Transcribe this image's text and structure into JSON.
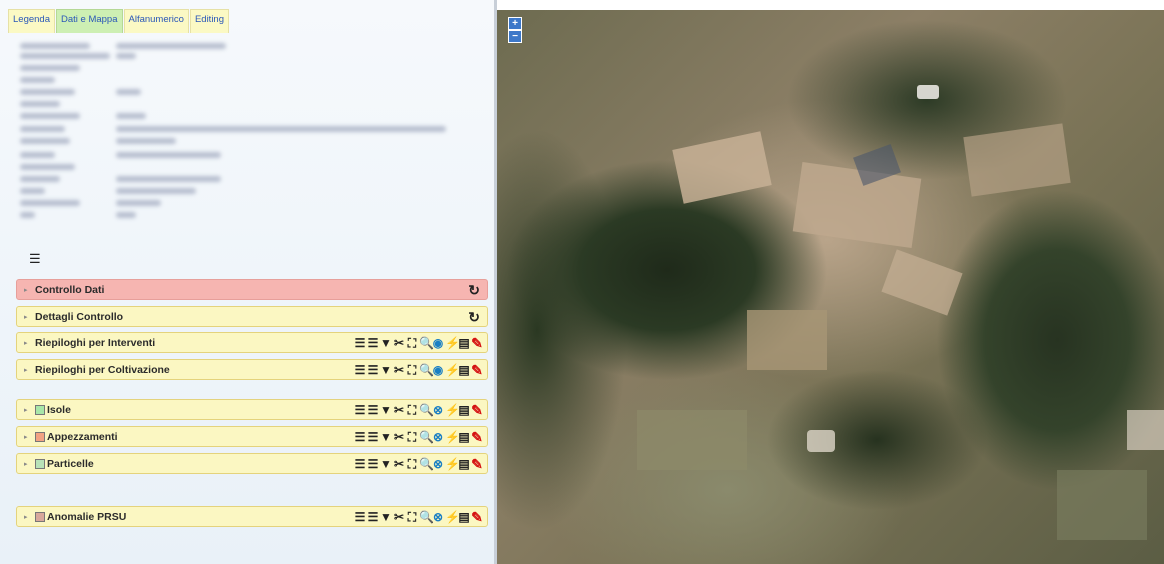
{
  "tabs": [
    {
      "label": "Legenda",
      "active": false
    },
    {
      "label": "Dati e Mappa",
      "active": true
    },
    {
      "label": "Alfanumerico",
      "active": false
    },
    {
      "label": "Editing",
      "active": false
    }
  ],
  "icons": {
    "list_toggle": "list-icon",
    "refresh": "refresh-icon",
    "caret": "caret-right-icon",
    "tools": [
      "list-icon",
      "filter-icon",
      "edit-attributes-icon",
      "select-area-icon",
      "zoom-to-icon",
      "visibility-icon",
      "style-icon",
      "notes-icon",
      "pencil-icon"
    ]
  },
  "glyphs": {
    "list_toggle": "☰",
    "refresh": "↻",
    "caret": "▸",
    "list": "☰",
    "filter": "▼",
    "edit_attributes": "✂",
    "select_area": "⛶",
    "zoom_to": "🔍",
    "visibility": "◉",
    "visibility_off": "⊗",
    "style": "⚡",
    "notes": "▤",
    "pencil": "✎",
    "zoom_in": "+",
    "zoom_out": "−"
  },
  "colors": {
    "row_yellow": "#fbf7c2",
    "row_red": "#f6b5b1",
    "swatch_isole": "#a8e6a8",
    "swatch_appezzamenti": "#f2a283",
    "swatch_particelle": "#b8e2b8",
    "swatch_anomalie": "#d8a89c",
    "tab_active": "#cdefb3"
  },
  "control_rows": [
    {
      "label": "Controllo Dati"
    },
    {
      "label": "Dettagli Controllo"
    },
    {
      "label": "Riepiloghi per Interventi"
    },
    {
      "label": "Riepiloghi per Coltivazione"
    }
  ],
  "layer_rows": [
    {
      "label": "Isole"
    },
    {
      "label": "Appezzamenti"
    },
    {
      "label": "Particelle"
    },
    {
      "label": "Anomalie PRSU"
    }
  ]
}
